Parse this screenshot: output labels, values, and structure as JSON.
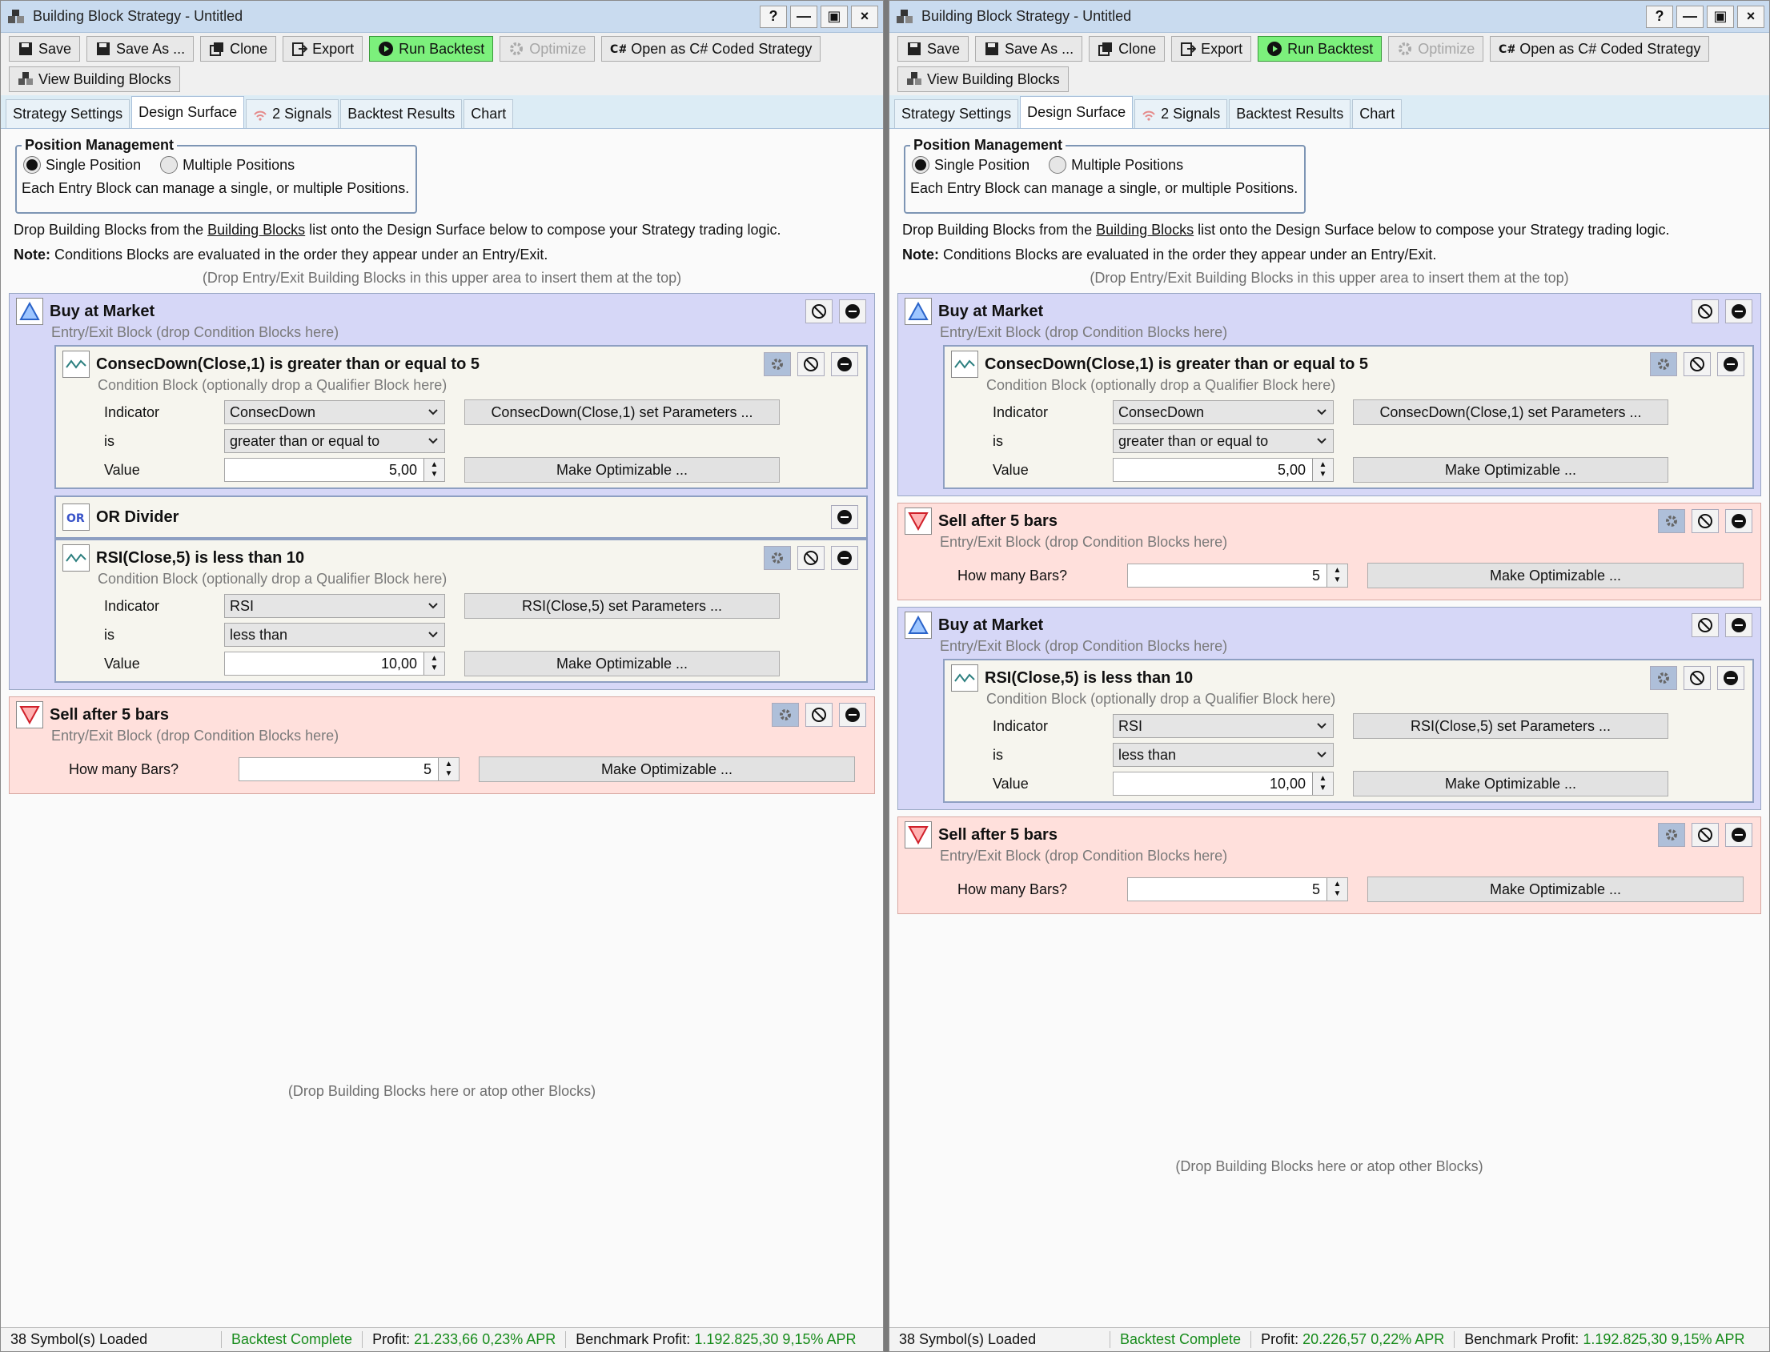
{
  "windows": [
    {
      "title": "Building Block Strategy - Untitled",
      "title_buttons": [
        "?",
        "—",
        "▣",
        "×"
      ],
      "toolbar": {
        "save": "Save",
        "save_as": "Save As ...",
        "clone": "Clone",
        "export": "Export",
        "run_backtest": "Run Backtest",
        "optimize": "Optimize",
        "open_csharp": "Open as C# Coded Strategy",
        "view_blocks": "View Building Blocks"
      },
      "tabs": [
        "Strategy Settings",
        "Design Surface",
        "2 Signals",
        "Backtest Results",
        "Chart"
      ],
      "position_management": {
        "legend": "Position Management",
        "single": "Single Position",
        "multiple": "Multiple Positions",
        "desc": "Each Entry Block can manage a single, or multiple Positions."
      },
      "info": {
        "pre": "Drop Building Blocks from the ",
        "link": "Building Blocks",
        "post": " list onto the Design Surface below to compose your Strategy trading logic.",
        "note_label": "Note:",
        "note_text": " Conditions Blocks are evaluated in the order they appear under an Entry/Exit.",
        "drop_top": "(Drop Entry/Exit Building Blocks in this upper area to insert them at the top)",
        "drop_bottom": "(Drop Building Blocks here or atop other Blocks)"
      },
      "blocks": {
        "buy_title": "Buy at Market",
        "entry_sub": "Entry/Exit Block (drop Condition Blocks here)",
        "cond_sub": "Condition Block (optionally drop a Qualifier Block here)",
        "cond1_title": "ConsecDown(Close,1) is greater than or equal to 5",
        "cond1_indicator": "ConsecDown",
        "cond1_is": "greater than or equal to",
        "cond1_value": "5,00",
        "cond1_params": "ConsecDown(Close,1) set Parameters ...",
        "or_title": "OR Divider",
        "cond2_title": "RSI(Close,5) is less than 10",
        "cond2_indicator": "RSI",
        "cond2_is": "less than",
        "cond2_value": "10,00",
        "cond2_params": "RSI(Close,5) set Parameters ...",
        "label_indicator": "Indicator",
        "label_is": "is",
        "label_value": "Value",
        "make_opt": "Make Optimizable ...",
        "sell_title": "Sell after 5 bars",
        "how_many": "How many Bars?",
        "bars_value": "5"
      },
      "status": {
        "symbols": "38 Symbol(s) Loaded",
        "complete": "Backtest Complete",
        "profit_label": "Profit:",
        "profit_value": "21.233,66 0,23% APR",
        "bench_label": "Benchmark Profit:",
        "bench_value": "1.192.825,30 9,15% APR"
      }
    },
    {
      "status": {
        "profit_value": "20.226,57 0,22% APR"
      }
    }
  ],
  "colors": {
    "run_green": "#7cf07c",
    "entry_bg": "#d6d7f7",
    "exit_bg": "#ffe0dc",
    "status_green": "#188c1c"
  }
}
